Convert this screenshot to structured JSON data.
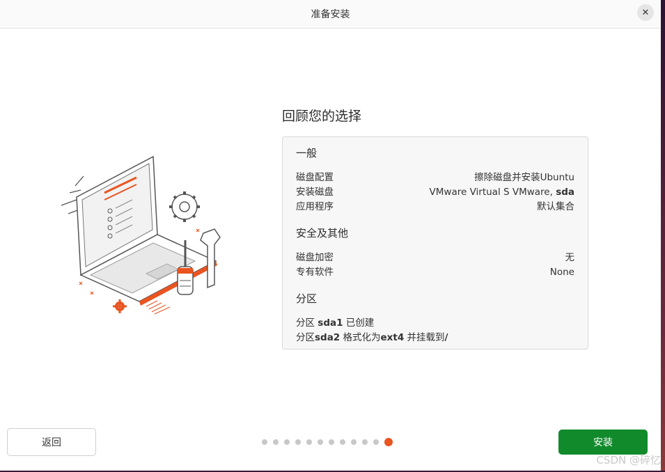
{
  "window": {
    "title": "准备安装",
    "close_icon": "close-icon"
  },
  "review": {
    "heading": "回顾您的选择",
    "general": {
      "title": "一般",
      "rows": [
        {
          "label": "磁盘配置",
          "value": "擦除磁盘并安装Ubuntu",
          "value_bold": ""
        },
        {
          "label": "安装磁盘",
          "value": "VMware Virtual S VMware, ",
          "value_bold": "sda"
        },
        {
          "label": "应用程序",
          "value": "默认集合",
          "value_bold": ""
        }
      ]
    },
    "security": {
      "title": "安全及其他",
      "rows": [
        {
          "label": "磁盘加密",
          "value": "无"
        },
        {
          "label": "专有软件",
          "value": "None"
        }
      ]
    },
    "partitions": {
      "title": "分区",
      "line1": {
        "prefix": "分区 ",
        "device": "sda1",
        "suffix": " 已创建"
      },
      "line2": {
        "prefix": "分区",
        "device": "sda2",
        "mid": " 格式化为",
        "fs": "ext4",
        "mid2": " 并挂载到",
        "mount": "/"
      }
    }
  },
  "footer": {
    "back_label": "返回",
    "install_label": "安装",
    "progress": {
      "total_steps": 12,
      "current_step": 12
    }
  },
  "watermark": "CSDN @碎忆",
  "colors": {
    "accent": "#e95420",
    "install_button": "#118a2c",
    "dot_inactive": "#c8c8c8"
  }
}
